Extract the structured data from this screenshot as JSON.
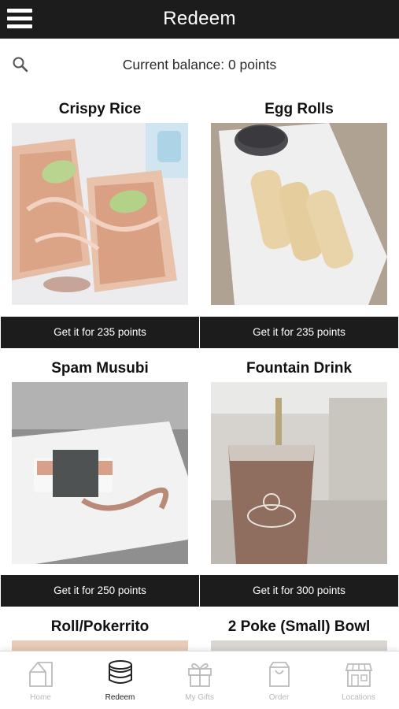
{
  "header": {
    "title": "Redeem",
    "menu_icon": "hamburger-menu-icon"
  },
  "balance": {
    "text": "Current balance: 0 points",
    "search_icon": "search-icon"
  },
  "items": [
    {
      "name": "Crispy Rice",
      "button": "Get it for 235 points"
    },
    {
      "name": "Egg Rolls",
      "button": "Get it for 235 points"
    },
    {
      "name": "Spam Musubi",
      "button": "Get it for 250 points"
    },
    {
      "name": "Fountain Drink",
      "button": "Get it for 300 points"
    },
    {
      "name": "Roll/Pokerrito",
      "button": ""
    },
    {
      "name": "2 Poke (Small) Bowl",
      "button": ""
    }
  ],
  "tabs": [
    {
      "label": "Home",
      "icon": "home-icon",
      "active": false
    },
    {
      "label": "Redeem",
      "icon": "coins-icon",
      "active": true
    },
    {
      "label": "My Gifts",
      "icon": "gift-icon",
      "active": false
    },
    {
      "label": "Order",
      "icon": "shopping-bag-icon",
      "active": false
    },
    {
      "label": "Locations",
      "icon": "store-icon",
      "active": false
    }
  ],
  "colors": {
    "bar": "#1c1c1c",
    "text_on_bar": "#ffffff",
    "inactive_tab": "#b8b8b8",
    "active_tab": "#222222"
  }
}
